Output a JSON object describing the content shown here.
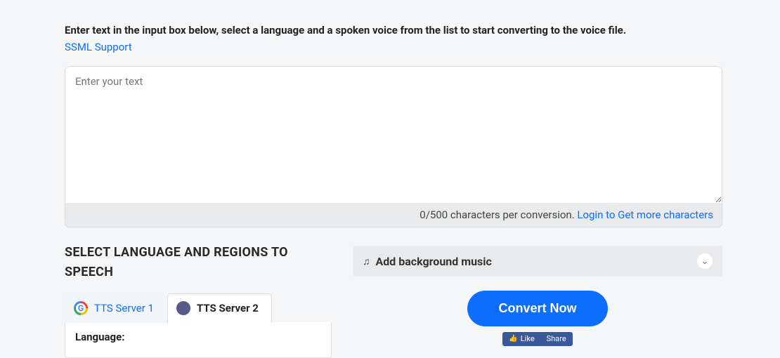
{
  "instruction": "Enter text in the input box below, select a language and a spoken voice from the list to start converting to the voice file.",
  "ssml_link": "SSML Support",
  "textarea": {
    "placeholder": "Enter your text",
    "value": ""
  },
  "char_info": {
    "counter": "0/500 characters per conversion. ",
    "login_link": "Login to Get more characters"
  },
  "select_heading": "SELECT LANGUAGE AND REGIONS TO SPEECH",
  "tabs": {
    "server1": "TTS Server 1",
    "server2": "TTS Server 2"
  },
  "language_label": "Language:",
  "bg_music_label": "Add background music",
  "convert_button": "Convert Now",
  "fb": {
    "like": "Like",
    "share": "Share"
  }
}
